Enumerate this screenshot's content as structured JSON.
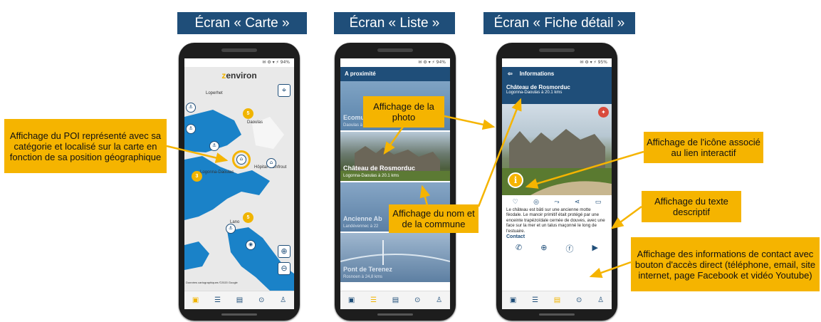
{
  "titles": {
    "carte": "Écran « Carte »",
    "liste": "Écran « Liste »",
    "fiche": "Écran « Fiche détail »"
  },
  "colors": {
    "accent": "#f5b400",
    "brand": "#1f4e79",
    "water": "#1a82c8"
  },
  "statusbar": {
    "carte": "94%",
    "liste": "94%",
    "fiche": "95%"
  },
  "map": {
    "logo_prefix": "z",
    "logo_rest": "environ",
    "labels": {
      "loperhet": "Loperhet",
      "daoulas": "Daoulas",
      "logonna": "Logonna-Daoulas",
      "hopital": "Hôpital-Camfrout",
      "lano": "Lano",
      "google": "Données cartographiques ©2020 Google"
    },
    "clusters": [
      "5",
      "3",
      "5"
    ]
  },
  "list": {
    "header": "A proximité",
    "items": [
      {
        "title": "Ecomu",
        "subtitle": "Daoulas à 18,2 kms"
      },
      {
        "title": "Château de Rosmorduc",
        "subtitle": "Logonna-Daoulas à 20.1 kms"
      },
      {
        "title": "Ancienne Ab",
        "subtitle": "Landévennec à 22"
      },
      {
        "title": "Pont de Terenez",
        "subtitle": "Rosnoen à 24,8 kms"
      }
    ]
  },
  "detail": {
    "header": "Informations",
    "title": "Château de Rosmorduc",
    "subtitle": "Logonna-Daoulas à 20.1 kms",
    "description": "Le château est bâti sur une ancienne motte féodale. Le manoir primitif était protégé par une enceinte trapézoïdale cernée de douves, avec une face sur la mer et un talus maçonné le long de l'estuaire.",
    "contact_label": "Contact"
  },
  "callouts": {
    "poi": "Affichage du POI représenté avec sa catégorie et localisé sur la carte en fonction de sa position géographique",
    "photo": "Affichage de la photo",
    "nom": "Affichage du nom et de la commune",
    "icone": "Affichage de l'icône associé au lien interactif",
    "texte": "Affichage du texte descriptif",
    "contact": "Affichage des informations de contact avec bouton d'accès direct (téléphone, email, site internet, page Facebook et vidéo Youtube)"
  },
  "icons": [
    "home-icon",
    "list-icon",
    "map-icon",
    "pin-icon",
    "user-icon"
  ]
}
